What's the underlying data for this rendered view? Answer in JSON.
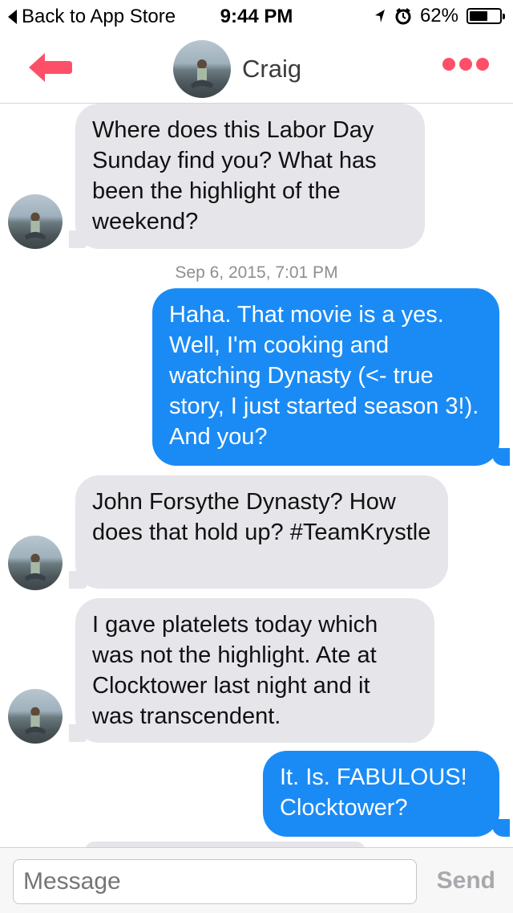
{
  "status_bar": {
    "back_label": "Back to App Store",
    "time": "9:44 PM",
    "battery": "62%",
    "battery_level": 0.62
  },
  "header": {
    "name": "Craig"
  },
  "timestamp": "Sep 6, 2015, 7:01 PM",
  "messages": [
    {
      "from": "Craig",
      "text": "Where does this Labor Day Sunday find you? What has been the highlight of the weekend?"
    },
    {
      "from": "me",
      "text": "Haha. That movie is a yes. Well, I'm cooking and watching Dynasty (<- true story,  I just started season 3!). And you?"
    },
    {
      "from": "Craig",
      "text": "John Forsythe Dynasty? How does that hold up? #TeamKrystle"
    },
    {
      "from": "Craig",
      "text": "I gave platelets today which was not the highlight. Ate at Clocktower last night and it was transcendent."
    },
    {
      "from": "me",
      "text": "It. Is. FABULOUS! Clocktower?"
    }
  ],
  "composer": {
    "placeholder": "Message",
    "send_label": "Send"
  },
  "colors": {
    "accent": "#fd5068",
    "outgoing_bubble": "#1a8bf5",
    "incoming_bubble": "#e5e5ea"
  },
  "icons": {
    "back": "left-arrow-icon",
    "more": "more-dots-icon",
    "location": "location-arrow-icon",
    "alarm": "alarm-icon",
    "battery": "battery-icon"
  }
}
